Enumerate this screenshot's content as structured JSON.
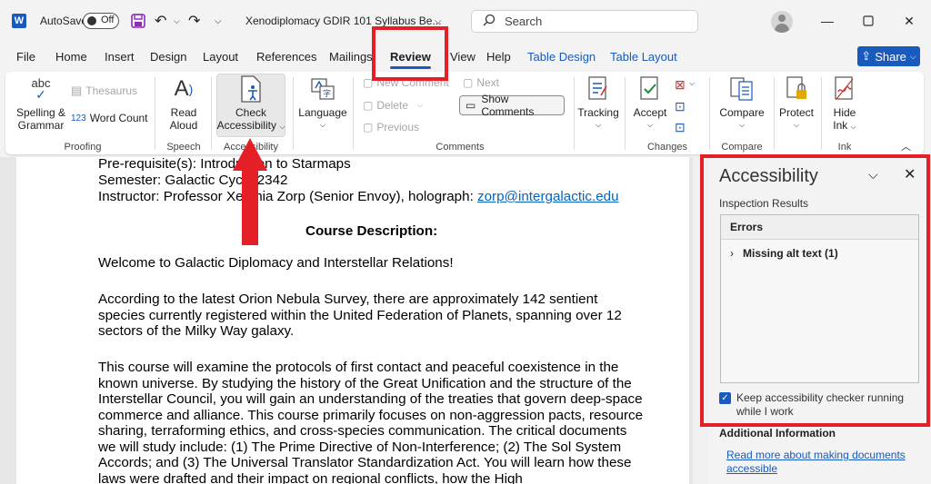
{
  "titlebar": {
    "autosave_label": "AutoSave",
    "autosave_state": "Off",
    "doc_title": "Xenodiplomacy GDIR 101 Syllabus Be...",
    "search_placeholder": "Search"
  },
  "menu_tabs": [
    "File",
    "Home",
    "Insert",
    "Design",
    "Layout",
    "References",
    "Mailings",
    "Review",
    "View",
    "Help",
    "Table Design",
    "Table Layout"
  ],
  "share_label": "Share",
  "ribbon": {
    "proofing": {
      "spelling": "Spelling &",
      "grammar": "Grammar",
      "thesaurus": "Thesaurus",
      "word_count": "Word Count",
      "label": "Proofing",
      "icon_text": "abc"
    },
    "speech": {
      "read": "Read",
      "aloud": "Aloud",
      "label": "Speech"
    },
    "accessibility": {
      "check": "Check",
      "accessibility": "Accessibility",
      "label": "Accessibility"
    },
    "language": {
      "label_btn": "Language"
    },
    "comments": {
      "new": "New Comment",
      "delete": "Delete",
      "previous": "Previous",
      "next": "Next",
      "show": "Show Comments",
      "label": "Comments"
    },
    "tracking": {
      "label_btn": "Tracking"
    },
    "changes": {
      "accept": "Accept",
      "label": "Changes"
    },
    "compare": {
      "btn": "Compare",
      "label": "Compare"
    },
    "protect": {
      "btn": "Protect"
    },
    "ink": {
      "hide": "Hide",
      "ink": "Ink",
      "label": "Ink"
    }
  },
  "document": {
    "prereq": "Pre-requisite(s): Introduction to Starmaps",
    "semester": "Semester: Galactic Cycle 2342",
    "instructor_prefix": "Instructor: Professor Xenthia Zorp (Senior Envoy), holograph: ",
    "instructor_email": "zorp@intergalactic.edu",
    "course_desc_heading": "Course Description:",
    "welcome": "Welcome to Galactic Diplomacy and Interstellar Relations!",
    "para1": "According to the latest Orion Nebula Survey, there are approximately 142 sentient species currently registered within the United Federation of Planets, spanning over 12 sectors of the Milky Way galaxy.",
    "para2": "This course will examine the protocols of first contact and peaceful coexistence in the known universe. By studying the history of the Great Unification and the structure of the Interstellar Council, you will gain an understanding of the treaties that govern deep-space commerce and alliance. This course primarily focuses on non-aggression pacts, resource sharing, terraforming ethics, and cross-species communication. The critical documents we will study include: (1) The Prime Directive of Non-Interference; (2) The Sol System Accords; and (3) The Universal Translator Standardization Act. You will learn how these laws were drafted and their impact on regional conflicts, how the High"
  },
  "pane": {
    "title": "Accessibility",
    "inspection": "Inspection Results",
    "errors_header": "Errors",
    "error_item": "Missing alt text (1)",
    "keep_running": "Keep accessibility checker running while I work",
    "additional": "Additional Information",
    "read_more": "Read more about making documents accessible"
  },
  "colors": {
    "accent": "#185abd",
    "annotation": "#e41f26"
  }
}
